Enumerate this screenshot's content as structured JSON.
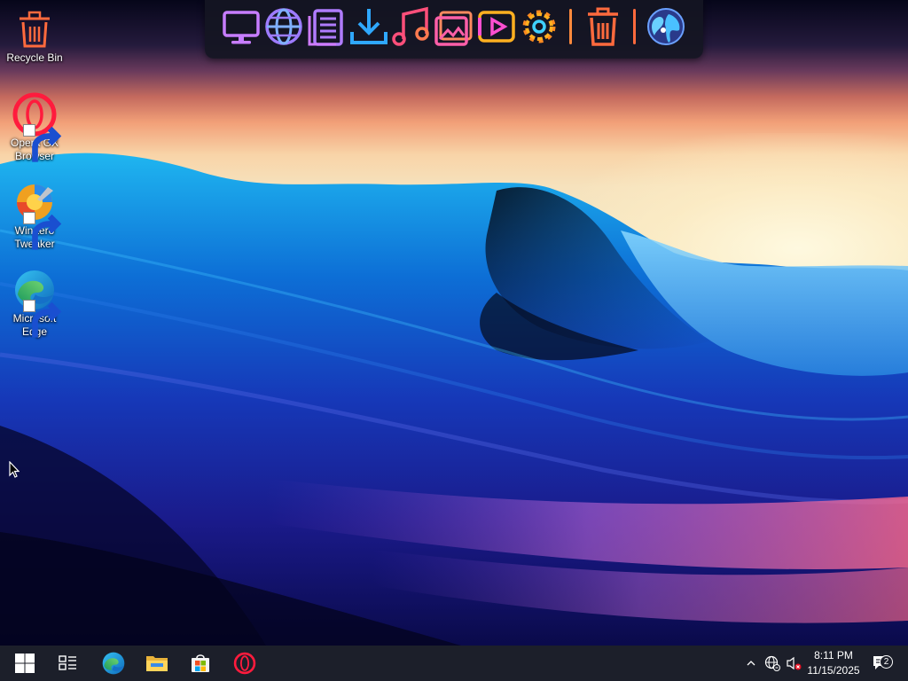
{
  "desktop": {
    "icons": [
      {
        "label": "Recycle Bin",
        "icon": "recycle-bin-icon",
        "shortcut": false
      },
      {
        "label": "Opera GX\nBrowser",
        "icon": "opera-gx-icon",
        "shortcut": true
      },
      {
        "label": "Winaero\nTweaker",
        "icon": "winaero-tweaker-icon",
        "shortcut": true
      },
      {
        "label": "Microsoft\nEdge",
        "icon": "edge-icon",
        "shortcut": true
      }
    ]
  },
  "dock": {
    "items": [
      {
        "icon": "computer-icon",
        "color": "#c77dff"
      },
      {
        "icon": "globe-icon",
        "color": "#9d7bff"
      },
      {
        "icon": "documents-icon",
        "color": "#b07cff"
      },
      {
        "icon": "downloads-icon",
        "color": "#2fa8ff"
      },
      {
        "icon": "music-icon",
        "color": "#ff4f7a"
      },
      {
        "icon": "pictures-icon",
        "color": "#ff5fa8"
      },
      {
        "icon": "videos-icon",
        "color": "#ffb020"
      },
      {
        "icon": "settings-icon",
        "color": "#ffb020"
      },
      {
        "icon": "trash-icon",
        "color": "#ff6a3d"
      },
      {
        "icon": "world-icon",
        "color": "#4a7bff"
      }
    ],
    "separator_colors": [
      "#ff8a3d",
      "#ff6a3d"
    ]
  },
  "taskbar": {
    "pinned": [
      {
        "icon": "start-windows-icon"
      },
      {
        "icon": "task-view-icon"
      },
      {
        "icon": "edge-icon"
      },
      {
        "icon": "file-explorer-icon"
      },
      {
        "icon": "microsoft-store-icon"
      },
      {
        "icon": "opera-gx-icon"
      }
    ],
    "tray": {
      "icons": [
        "chevron-up-icon",
        "network-icon",
        "volume-muted-icon"
      ],
      "time": "8:11 PM",
      "date": "11/15/2025",
      "notification_count": "2"
    }
  },
  "colors": {
    "taskbar_bg": "#1c1f2a",
    "dock_bg": "#14162a",
    "opera_red": "#ff1b3d"
  }
}
